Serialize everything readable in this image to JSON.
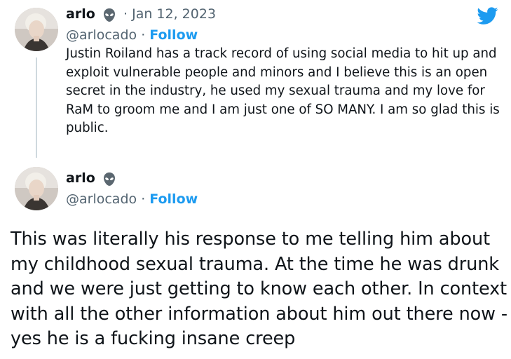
{
  "tweet1": {
    "display_name": "arlo",
    "date_sep": "·",
    "date": "Jan 12, 2023",
    "handle": "@arlocado",
    "follow_sep": "·",
    "follow_label": "Follow",
    "text": "Justin Roiland has a track record of using social media to hit up and exploit vulnerable people and minors and I believe this is an open secret in the industry, he used my sexual trauma and my love for RaM to groom me and I am just one of SO MANY. I am so glad this is public."
  },
  "tweet2": {
    "display_name": "arlo",
    "handle": "@arlocado",
    "follow_sep": "·",
    "follow_label": "Follow",
    "text": "This was literally his response to me telling him about my childhood sexual trauma. At the time he was drunk and we were just getting to know each other. In context with all the other information about him out there now - yes he is a fucking insane creep"
  },
  "colors": {
    "accent": "#1d9bf0",
    "text": "#0f1419",
    "secondary_text": "#536471",
    "thread_line": "#cfd9de"
  },
  "icons": {
    "logo": "twitter-bird-icon",
    "name_emoji": "alien-icon"
  }
}
